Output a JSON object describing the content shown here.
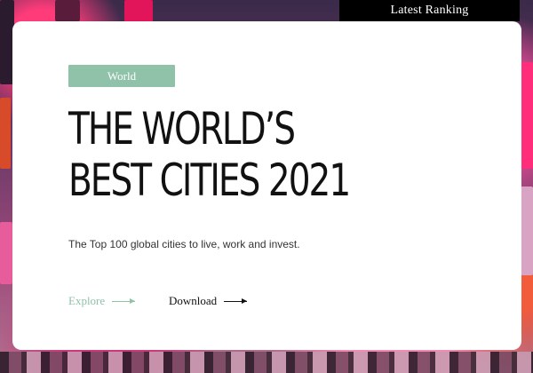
{
  "header": {
    "tab_label": "Latest Ranking"
  },
  "hero": {
    "tag": "World",
    "title_line_1": "THE WORLD’S",
    "title_line_2": "BEST CITIES 2021",
    "subtitle": "The Top 100 global cities to live, work and invest.",
    "explore_label": "Explore",
    "download_label": "Download"
  },
  "colors": {
    "accent": "#8fc2a9",
    "text": "#111111",
    "tab_bg": "#000000"
  },
  "icons": {
    "explore_arrow": "arrow-right-icon",
    "download_arrow": "arrow-right-icon"
  }
}
